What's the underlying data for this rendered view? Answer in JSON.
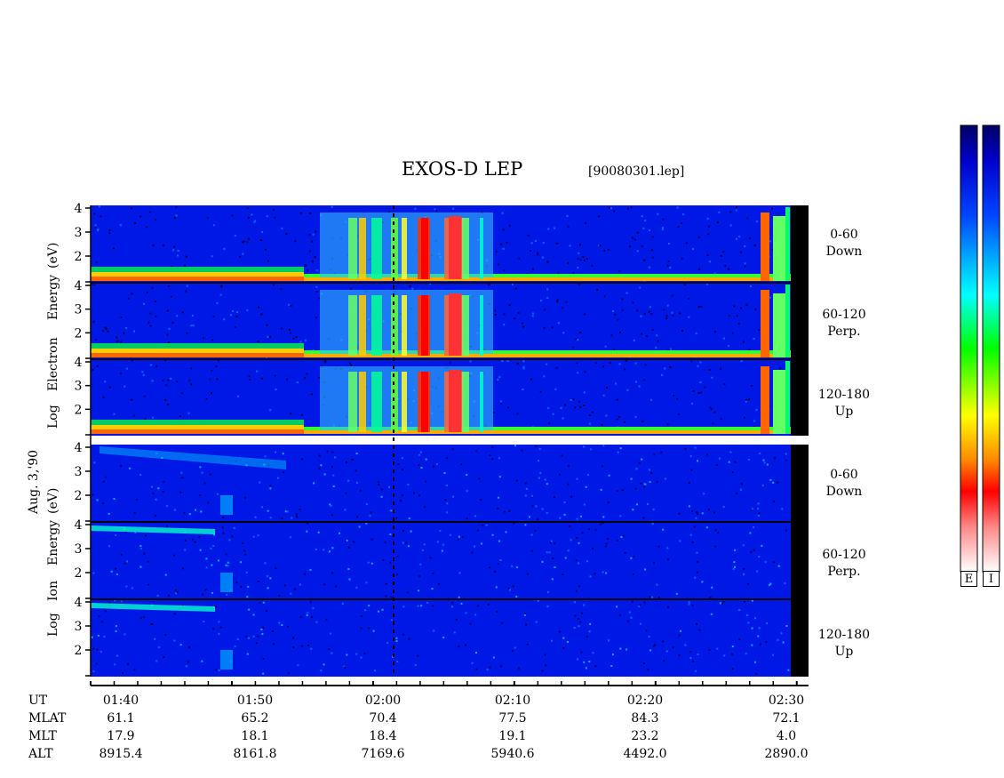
{
  "header": {
    "title": "EXOS-D LEP",
    "filename": "[90080301.lep]"
  },
  "date_label": "Aug. 3,'90",
  "electron_ylabel": [
    "Log",
    "Electron",
    "Energy",
    "(eV)"
  ],
  "ion_ylabel": [
    "Log",
    "Ion",
    "Energy",
    "(eV)"
  ],
  "panels": [
    {
      "group": "electron",
      "angle": "0-60",
      "dir": "Down"
    },
    {
      "group": "electron",
      "angle": "60-120",
      "dir": "Perp."
    },
    {
      "group": "electron",
      "angle": "120-180",
      "dir": "Up"
    },
    {
      "group": "ion",
      "angle": "0-60",
      "dir": "Down"
    },
    {
      "group": "ion",
      "angle": "60-120",
      "dir": "Perp."
    },
    {
      "group": "ion",
      "angle": "120-180",
      "dir": "Up"
    }
  ],
  "chart_data": {
    "type": "heatmap",
    "title": "EXOS-D LEP",
    "y_ticks": [
      "4",
      "3",
      "2"
    ],
    "ylim": [
      1,
      4
    ],
    "x_ticks": [
      "01:40",
      "01:50",
      "02:00",
      "02:10",
      "02:20",
      "02:30"
    ],
    "ephemeris": [
      {
        "label": "UT",
        "values": [
          "01:40",
          "01:50",
          "02:00",
          "02:10",
          "02:20",
          "02:30"
        ]
      },
      {
        "label": "MLAT",
        "values": [
          "61.1",
          "65.2",
          "70.4",
          "77.5",
          "84.3",
          "72.1"
        ]
      },
      {
        "label": "MLT",
        "values": [
          "17.9",
          "18.1",
          "18.4",
          "19.1",
          "23.2",
          "4.0"
        ]
      },
      {
        "label": "ALT",
        "values": [
          "8915.4",
          "8161.8",
          "7169.6",
          "5940.6",
          "4492.0",
          "2890.0"
        ]
      }
    ],
    "colorbar_labels": [
      "E",
      "I"
    ],
    "colorscale": [
      "#000066",
      "#0000ff",
      "#0088ff",
      "#00ffff",
      "#00ff00",
      "#ffff00",
      "#ff8800",
      "#ff0000",
      "#ffffff"
    ]
  }
}
